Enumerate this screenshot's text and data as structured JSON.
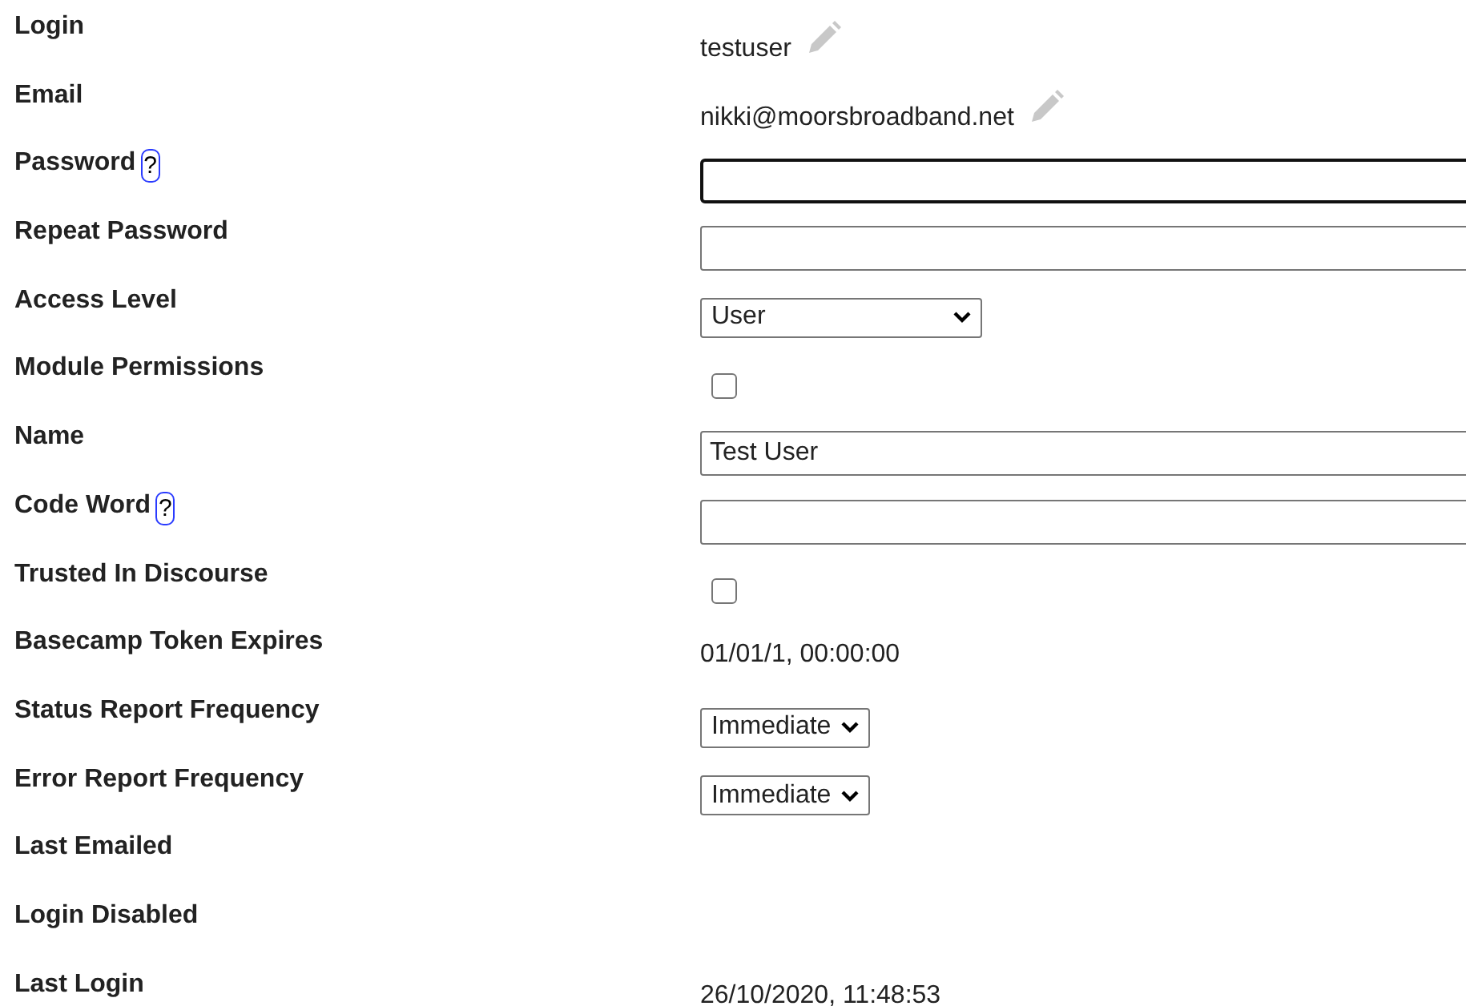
{
  "rows": [
    {
      "label": "Login",
      "kind": "editable",
      "value": "testuser"
    },
    {
      "label": "Email",
      "kind": "editable",
      "value": "nikki@moorsbroadband.net"
    },
    {
      "label": "Password",
      "help_mark": "?",
      "kind": "input",
      "value": "",
      "focused": true
    },
    {
      "label": "Repeat Password",
      "kind": "input",
      "value": "",
      "focused": false
    },
    {
      "label": "Access Level",
      "kind": "select",
      "value": "User",
      "wide": true
    },
    {
      "label": "Module Permissions",
      "kind": "checkbox",
      "checked": false
    },
    {
      "label": "Name",
      "kind": "input",
      "value": "Test User",
      "focused": false
    },
    {
      "label": "Code Word",
      "help_mark": "?",
      "kind": "input",
      "value": "",
      "focused": false
    },
    {
      "label": "Trusted In Discourse",
      "kind": "checkbox",
      "checked": false
    },
    {
      "label": "Basecamp Token Expires",
      "kind": "text",
      "value": "01/01/1, 00:00:00"
    },
    {
      "label": "Status Report Frequency",
      "kind": "select",
      "value": "Immediate",
      "wide": false
    },
    {
      "label": "Error Report Frequency",
      "kind": "select",
      "value": "Immediate",
      "wide": false
    },
    {
      "label": "Last Emailed",
      "kind": "empty"
    },
    {
      "label": "Login Disabled",
      "kind": "empty"
    },
    {
      "label": "Last Login",
      "kind": "text",
      "value": "26/10/2020, 11:48:53"
    }
  ]
}
